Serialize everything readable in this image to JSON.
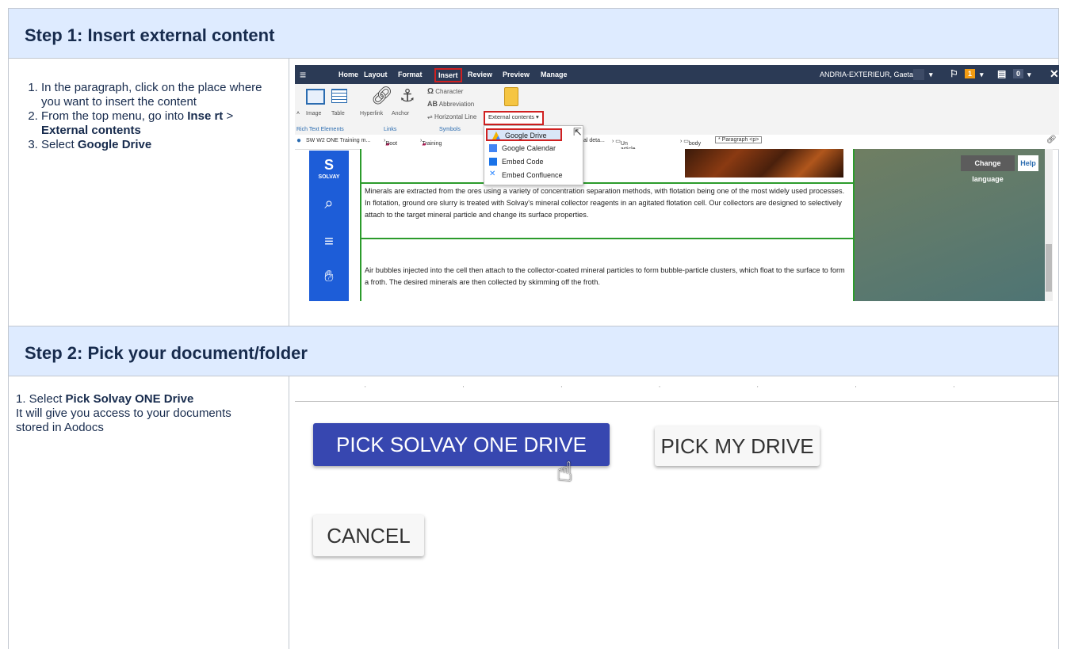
{
  "step1": {
    "title": "Step 1: Insert external content",
    "instructions": {
      "item1": "In the paragraph, click on the place where you want to insert the content",
      "item2_prefix": "From the top menu, go into ",
      "item2_bold1": "Inse rt",
      "item2_sep": " > ",
      "item2_bold2": "External contents",
      "item3_prefix": "Select ",
      "item3_bold": "Google Drive"
    },
    "editor": {
      "menu": [
        "Home",
        "Layout",
        "Format",
        "Insert",
        "Review",
        "Preview",
        "Manage"
      ],
      "user": "ANDRIA-EXTERIEUR, Gaetan",
      "flag_count": "1",
      "task_count": "0",
      "ribbon": {
        "image": "Image",
        "table": "Table",
        "hyperlink": "Hyperlink",
        "anchor": "Anchor",
        "character": "Character",
        "abbreviation": "Abbreviation",
        "horizontal_line": "Horizontal Line",
        "external_contents": "External contents ▾",
        "group_rich": "Rich Text Elements",
        "group_links": "Links",
        "group_symbols": "Symbols"
      },
      "breadcrumb": {
        "c1": "SW W2 ONE Training m...",
        "c2": "Root",
        "c3": "Training",
        "c4": "al deta...",
        "c5": "Un article de for",
        "c6": "body",
        "c7": "* Paragraph <p>"
      },
      "dropdown": [
        "Google Drive",
        "Google Calendar",
        "Embed Code",
        "Embed Confluence"
      ],
      "sidebar_logo": "S",
      "sidebar_brand": "SOLVAY",
      "paragraph1": "Minerals are extracted from the ores using a variety of concentration separation methods, with flotation being one of the most widely used processes. In flotation, ground ore slurry is treated with Solvay's mineral collector reagents in an agitated flotation cell. Our collectors are designed to selectively attach to the target mineral particle and change its surface properties.",
      "paragraph2": "Air bubbles injected into the cell then attach to the collector-coated mineral particles to form bubble-particle clusters, which float to the surface to form a froth. The desired minerals are then collected by skimming off the froth.",
      "change_language": "Change language",
      "help": "Help"
    }
  },
  "step2": {
    "title": "Step 2: Pick your document/folder",
    "instruction_prefix": "1. Select ",
    "instruction_bold": "Pick Solvay ONE Drive",
    "instruction_line2": "It will give you access to your documents stored in Aodocs",
    "buttons": {
      "pick_solvay": "PICK SOLVAY ONE DRIVE",
      "pick_my": "PICK MY DRIVE",
      "cancel": "CANCEL"
    }
  },
  "colors": {
    "header_bg": "#deebff",
    "primary_button": "#3747b0",
    "editor_topbar": "#2b3a55",
    "solvay_blue": "#1d5dd8",
    "highlight_red": "#d02020"
  }
}
